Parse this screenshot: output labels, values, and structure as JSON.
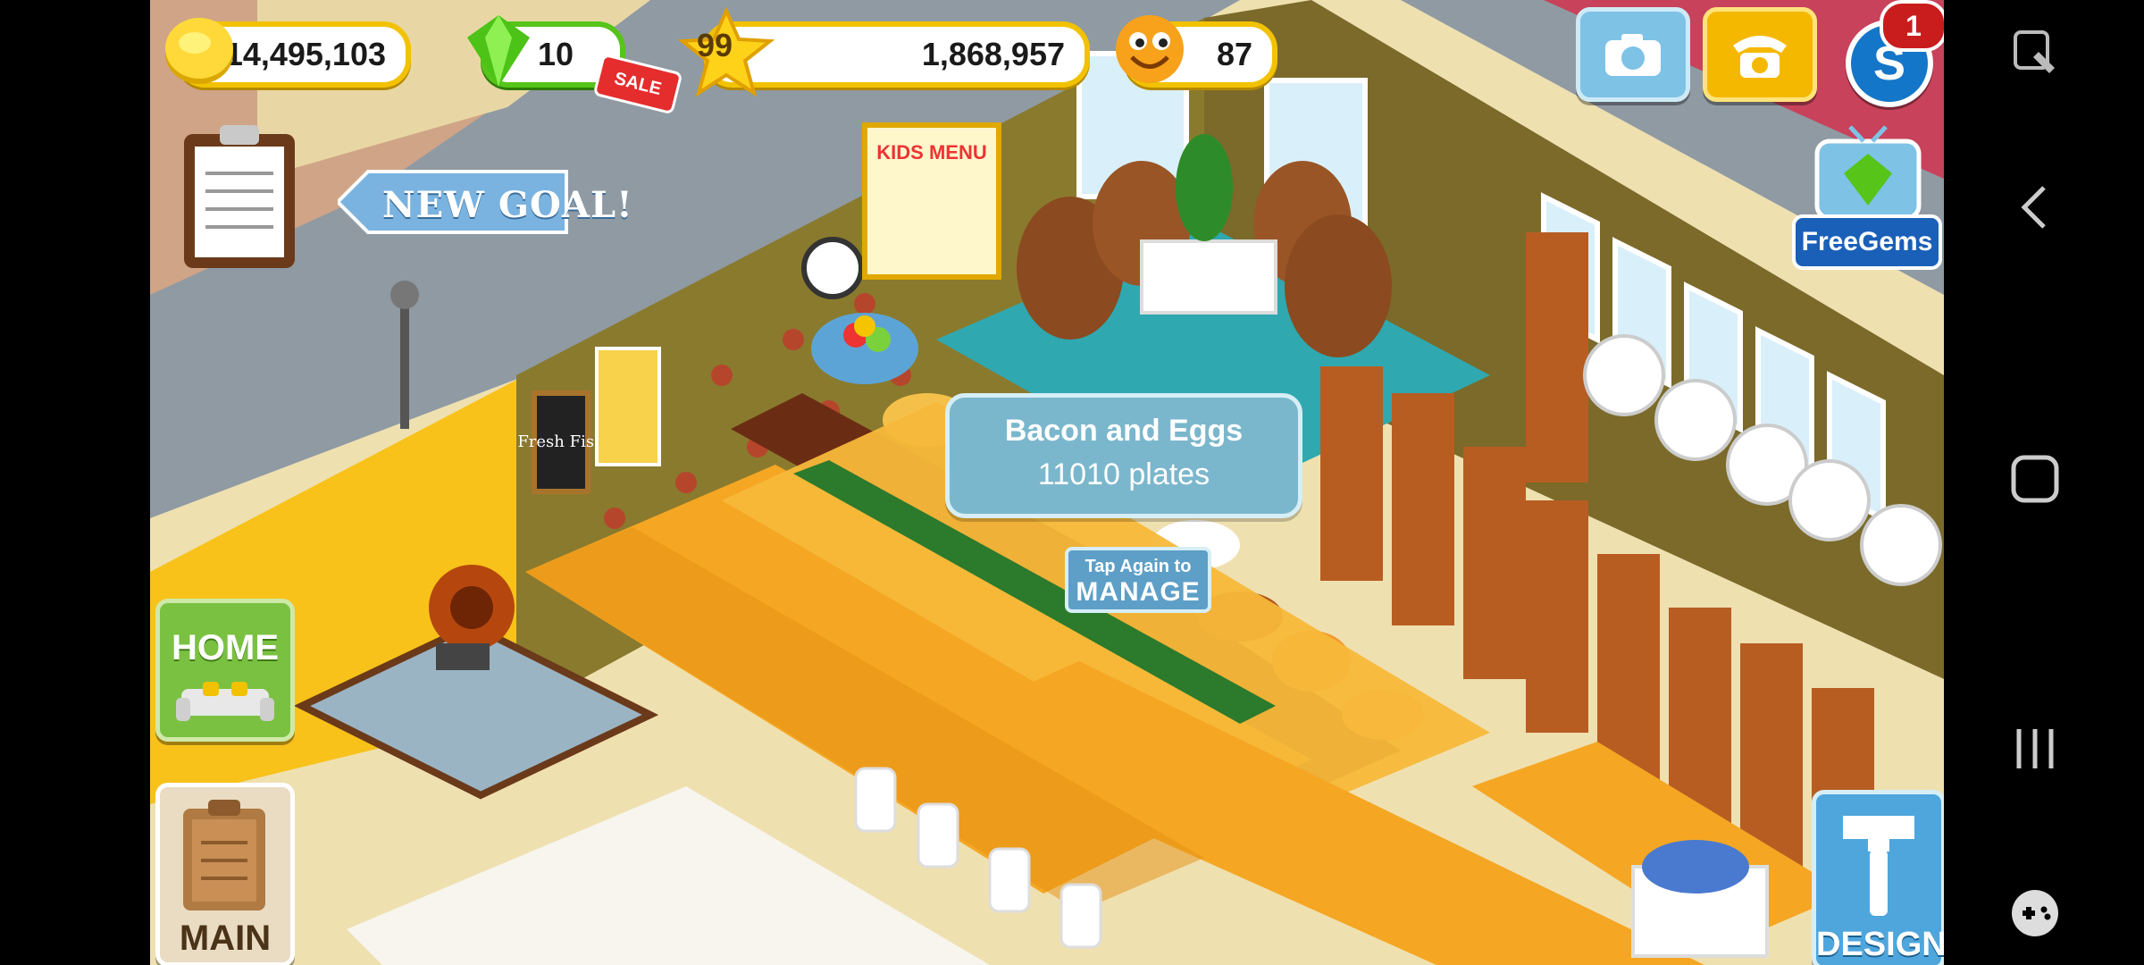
{
  "hud": {
    "coins": "14,495,103",
    "gems": "10",
    "sale_label": "SALE",
    "level": "99",
    "xp": "1,868,957",
    "happiness": "87",
    "notification_count": "1",
    "s_button_label": "S"
  },
  "goal": {
    "label": "NEW GOAL!"
  },
  "freegems": {
    "label": "FreeGems"
  },
  "tooltip": {
    "dish": "Bacon and Eggs",
    "plates": "11010 plates",
    "hint_line1": "Tap Again to",
    "hint_line2": "MANAGE"
  },
  "buttons": {
    "home": "HOME",
    "main": "MAIN",
    "design": "DESIGN"
  },
  "decor": {
    "fish_sign": "Fresh Fish",
    "menu_sign": "KIDS MENU"
  },
  "colors": {
    "coin": "#f2c200",
    "gem": "#56c419",
    "tooltip": "#7bb7cc",
    "table": "#f5a623",
    "wall": "#8a7a2e"
  }
}
